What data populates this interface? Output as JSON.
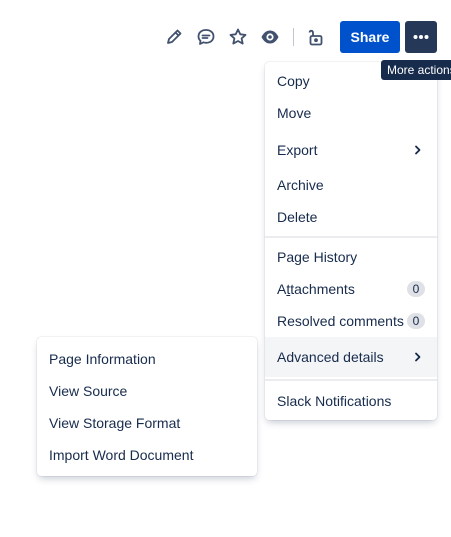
{
  "toolbar": {
    "icons": [
      "pencil-icon",
      "comment-icon",
      "star-icon",
      "eye-icon",
      "unlock-icon"
    ],
    "share_label": "Share",
    "more_icon": "more-dots-icon",
    "tooltip": "More actions"
  },
  "main_menu": {
    "group1": [
      "Copy",
      "Move",
      "Export",
      "Archive",
      "Delete"
    ],
    "page_history": "Page History",
    "attachments_prefix": "A",
    "attachments_underlined": "t",
    "attachments_rest": "tachments",
    "attachments_count": "0",
    "resolved_comments": "Resolved comments",
    "resolved_count": "0",
    "advanced_details": "Advanced details",
    "slack_notifications": "Slack Notifications"
  },
  "sub_menu": {
    "items": [
      "Page Information",
      "View Source",
      "View Storage Format",
      "Import Word Document"
    ]
  },
  "colors": {
    "share_bg": "#0052cc",
    "more_bg": "#253858",
    "tooltip_bg": "#172b4d",
    "text": "#172b4d",
    "badge_bg": "#dfe1e6"
  }
}
